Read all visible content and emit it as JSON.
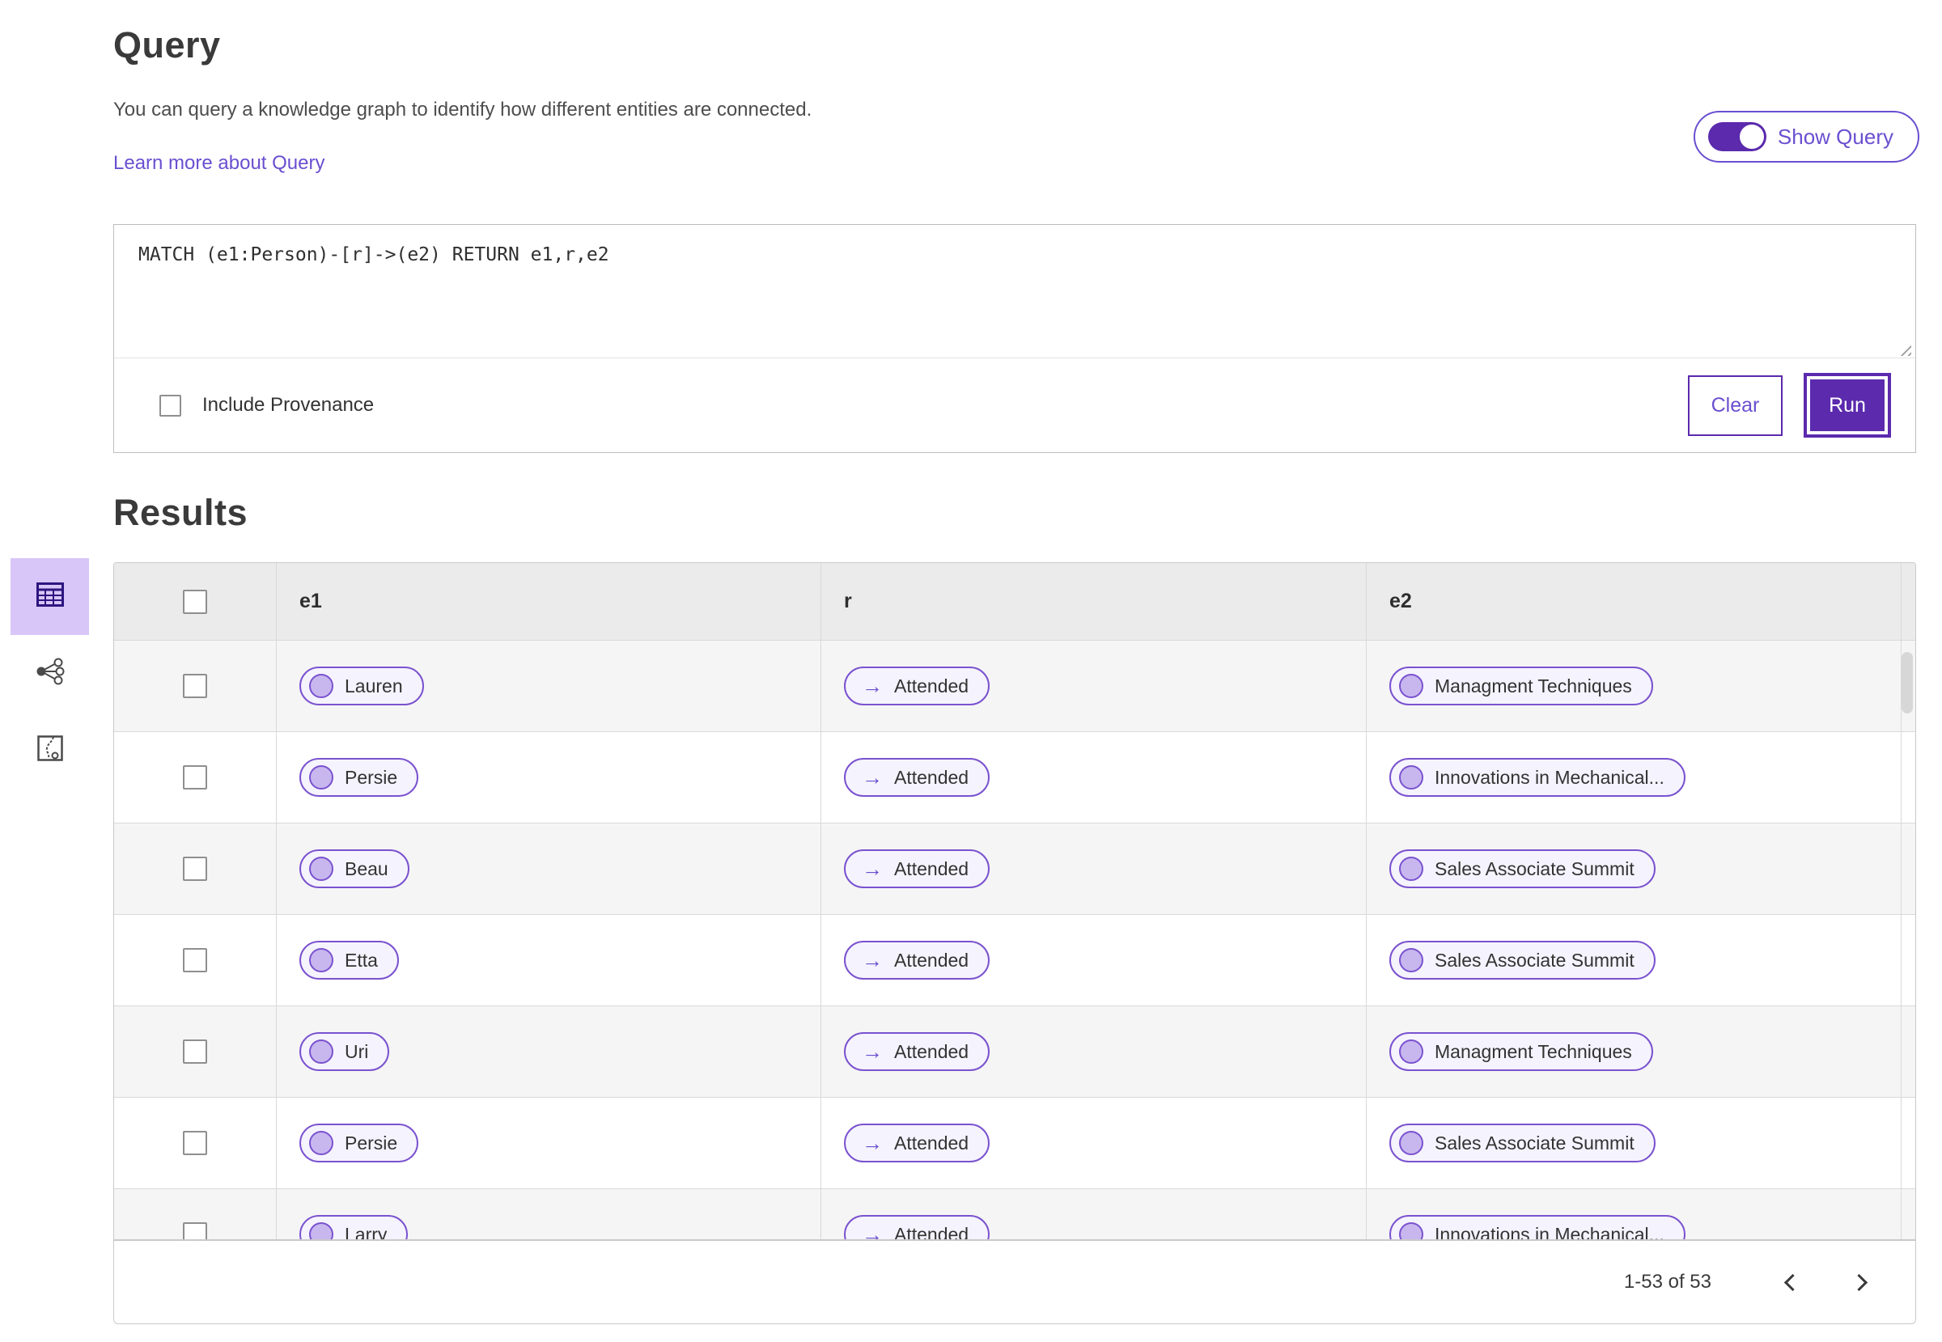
{
  "colors": {
    "accent": "#5b2aad",
    "link": "#6a4fd0",
    "pill-border": "#7a52cf",
    "pill-bg": "#f5f3fd",
    "circle-fill": "#c8b7ef"
  },
  "sidebar": {
    "items": [
      {
        "name": "table-view",
        "selected": true
      },
      {
        "name": "graph-view",
        "selected": false
      },
      {
        "name": "profile-view",
        "selected": false
      }
    ]
  },
  "query_section": {
    "title": "Query",
    "description": "You can query a knowledge graph to identify how different entities are connected.",
    "learn_more_label": "Learn more about Query",
    "show_query_label": "Show Query",
    "query_text": "MATCH (e1:Person)-[r]->(e2) RETURN e1,r,e2",
    "include_provenance_label": "Include Provenance",
    "clear_label": "Clear",
    "run_label": "Run"
  },
  "results_section": {
    "title": "Results",
    "columns": {
      "e1": "e1",
      "r": "r",
      "e2": "e2"
    },
    "relation_arrow": "→",
    "rows": [
      {
        "e1": "Lauren",
        "r": "Attended",
        "e2": "Managment Techniques"
      },
      {
        "e1": "Persie",
        "r": "Attended",
        "e2": "Innovations in Mechanical..."
      },
      {
        "e1": "Beau",
        "r": "Attended",
        "e2": "Sales Associate Summit"
      },
      {
        "e1": "Etta",
        "r": "Attended",
        "e2": "Sales Associate Summit"
      },
      {
        "e1": "Uri",
        "r": "Attended",
        "e2": "Managment Techniques"
      },
      {
        "e1": "Persie",
        "r": "Attended",
        "e2": "Sales Associate Summit"
      },
      {
        "e1": "Larry",
        "r": "Attended",
        "e2": "Innovations in Mechanical..."
      }
    ],
    "pagination": {
      "range_label": "1-53 of 53"
    }
  }
}
